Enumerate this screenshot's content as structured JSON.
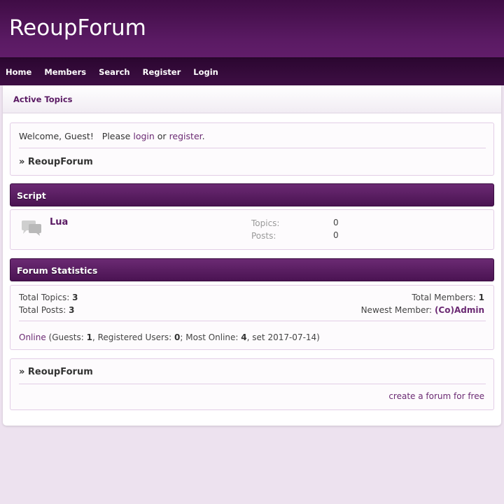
{
  "site": {
    "title": "ReoupForum"
  },
  "nav": [
    "Home",
    "Members",
    "Search",
    "Register",
    "Login"
  ],
  "subbar": {
    "active_topics": "Active Topics"
  },
  "welcome": {
    "greeting": "Welcome, Guest!",
    "please": "Please",
    "login_link": "login",
    "or": "or",
    "register_link": "register",
    "period": ".",
    "breadcrumb": "» ReoupForum"
  },
  "category": {
    "name": "Script",
    "forums": [
      {
        "name": "Lua",
        "topics_label": "Topics:",
        "topics": "0",
        "posts_label": "Posts:",
        "posts": "0"
      }
    ]
  },
  "stats": {
    "title": "Forum Statistics",
    "total_topics_label": "Total Topics:",
    "total_topics": "3",
    "total_posts_label": "Total Posts:",
    "total_posts": "3",
    "total_members_label": "Total Members:",
    "total_members": "1",
    "newest_member_label": "Newest Member:",
    "newest_member": "(Co)Admin",
    "online_link": "Online",
    "guests_label": "(Guests:",
    "guests": "1",
    "registered_label": ", Registered Users:",
    "registered": "0",
    "most_online_label": "; Most Online:",
    "most_online": "4",
    "most_online_date": ", set 2017-07-14)"
  },
  "footer": {
    "breadcrumb": "» ReoupForum",
    "create_link": "create a forum for free"
  },
  "colors": {
    "brand": "#5a1a63",
    "header_dark": "#3f0c45",
    "background": "#ede2ef"
  }
}
